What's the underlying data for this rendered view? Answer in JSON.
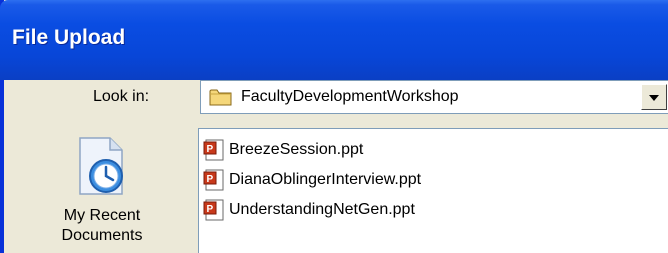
{
  "window": {
    "title": "File Upload"
  },
  "lookin": {
    "label": "Look in:",
    "value": "FacultyDevelopmentWorkshop",
    "icon": "folder-icon"
  },
  "places": [
    {
      "label_line1": "My Recent",
      "label_line2": "Documents",
      "icon": "recent-documents-icon"
    }
  ],
  "files": [
    {
      "name": "BreezeSession.ppt",
      "icon": "powerpoint-file-icon"
    },
    {
      "name": "DianaOblingerInterview.ppt",
      "icon": "powerpoint-file-icon"
    },
    {
      "name": "UnderstandingNetGen.ppt",
      "icon": "powerpoint-file-icon"
    }
  ]
}
